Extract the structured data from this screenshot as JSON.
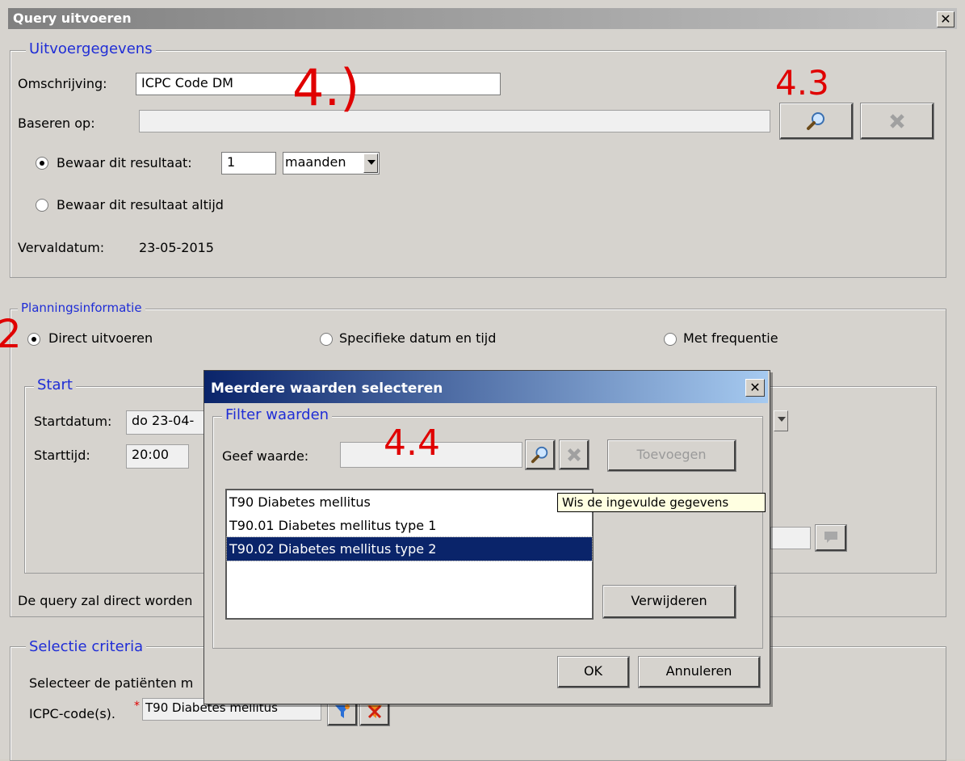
{
  "window": {
    "title": "Query uitvoeren",
    "close": "✕"
  },
  "uitvoer": {
    "legend": "Uitvoergegevens",
    "omschrijving_label": "Omschrijving:",
    "omschrijving_value": "ICPC Code DM",
    "baseren_label": "Baseren op:",
    "baseren_value": "",
    "bewaar_label": "Bewaar dit resultaat:",
    "bewaar_value": "1",
    "bewaar_unit": "maanden",
    "bewaar_altijd_label": "Bewaar dit resultaat altijd",
    "vervaldatum_label": "Vervaldatum:",
    "vervaldatum_value": "23-05-2015"
  },
  "planning": {
    "legend": "Planningsinformatie",
    "direct_label": "Direct uitvoeren",
    "specifiek_label": "Specifieke datum en tijd",
    "frequentie_label": "Met frequentie",
    "start_legend": "Start",
    "startdatum_label": "Startdatum:",
    "startdatum_value": "do 23-04-",
    "starttijd_label": "Starttijd:",
    "starttijd_value": "20:00",
    "info_text": "De query zal direct worden"
  },
  "selectie": {
    "legend": "Selectie criteria",
    "text": "Selecteer de patiënten m",
    "icpc_label": "ICPC-code(s).",
    "icpc_required": "*",
    "icpc_value": "T90 Diabetes mellitus"
  },
  "dialog": {
    "title": "Meerdere waarden selecteren",
    "close": "✕",
    "filter_legend": "Filter waarden",
    "geef_label": "Geef waarde:",
    "geef_value": "",
    "toevoegen": "Toevoegen",
    "items": [
      {
        "label": "T90 Diabetes mellitus",
        "selected": false
      },
      {
        "label": "T90.01 Diabetes mellitus type 1",
        "selected": false
      },
      {
        "label": "T90.02 Diabetes mellitus type 2",
        "selected": true
      }
    ],
    "verwijderen": "Verwijderen",
    "ok": "OK",
    "annuleren": "Annuleren",
    "tooltip": "Wis de ingevulde gegevens"
  },
  "annotations": {
    "a41": "4.)",
    "a43": "4.3",
    "a44": "4.4",
    "a2": "2"
  },
  "colors": {
    "accent": "#1f2dd6",
    "dialog_title": "#0a246a",
    "selection": "#0a246a",
    "annotation": "#e00000"
  }
}
